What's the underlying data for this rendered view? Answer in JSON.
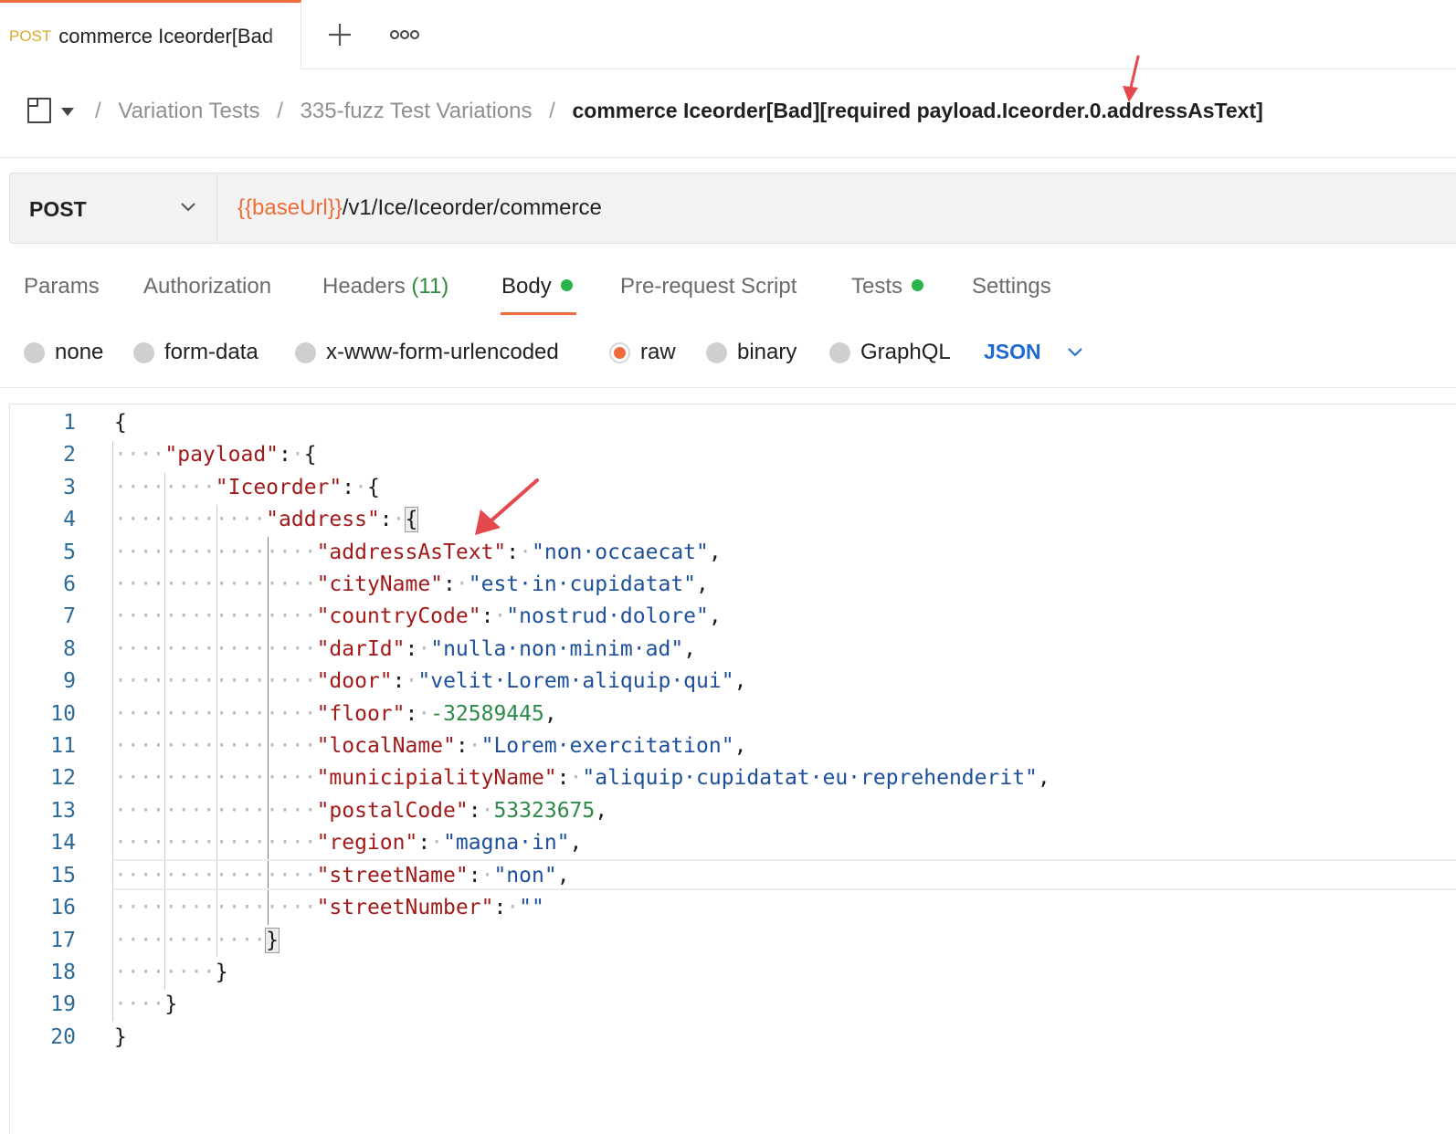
{
  "tab": {
    "method": "POST",
    "title": "commerce Iceorder[Bad"
  },
  "breadcrumb": {
    "items": [
      "Variation Tests",
      "335-fuzz Test Variations"
    ],
    "current": "commerce Iceorder[Bad][required payload.Iceorder.0.addressAsText]"
  },
  "request": {
    "method": "POST",
    "url_variable": "{{baseUrl}}",
    "url_path": "/v1/Ice/Iceorder/commerce"
  },
  "request_tabs": {
    "params": "Params",
    "authorization": "Authorization",
    "headers": "Headers",
    "headers_count": "(11)",
    "body": "Body",
    "pre_request": "Pre-request Script",
    "tests": "Tests",
    "settings": "Settings"
  },
  "body_types": {
    "none": "none",
    "form_data": "form-data",
    "urlencoded": "x-www-form-urlencoded",
    "raw": "raw",
    "binary": "binary",
    "graphql": "GraphQL",
    "selected": "raw",
    "format": "JSON"
  },
  "code": {
    "line_numbers": [
      "1",
      "2",
      "3",
      "4",
      "5",
      "6",
      "7",
      "8",
      "9",
      "10",
      "11",
      "12",
      "13",
      "14",
      "15",
      "16",
      "17",
      "18",
      "19",
      "20"
    ],
    "keys": [
      "\"payload\"",
      "\"Iceorder\"",
      "\"address\"",
      "\"addressAsText\"",
      "\"cityName\"",
      "\"countryCode\"",
      "\"darId\"",
      "\"door\"",
      "\"floor\"",
      "\"localName\"",
      "\"municipialityName\"",
      "\"postalCode\"",
      "\"region\"",
      "\"streetName\"",
      "\"streetNumber\""
    ],
    "values": {
      "addressAsText": "\"non·occaecat\"",
      "cityName": "\"est·in·cupidatat\"",
      "countryCode": "\"nostrud·dolore\"",
      "darId": "\"nulla·non·minim·ad\"",
      "door": "\"velit·Lorem·aliquip·qui\"",
      "floor": "-32589445",
      "localName": "\"Lorem·exercitation\"",
      "municipialityName": "\"aliquip·cupidatat·eu·reprehenderit\"",
      "postalCode": "53323675",
      "region": "\"magna·in\"",
      "streetName": "\"non\"",
      "streetNumber": "\"\""
    }
  },
  "colors": {
    "accent": "#f26b3a",
    "method_tab": "#d9a92b",
    "status_dot": "#2ab24c",
    "json_select": "#1f6ad1",
    "json_key": "#a11a1a",
    "json_string": "#1d4f9a",
    "json_number": "#2f8a4a",
    "annotation_arrow": "#e5484d"
  }
}
